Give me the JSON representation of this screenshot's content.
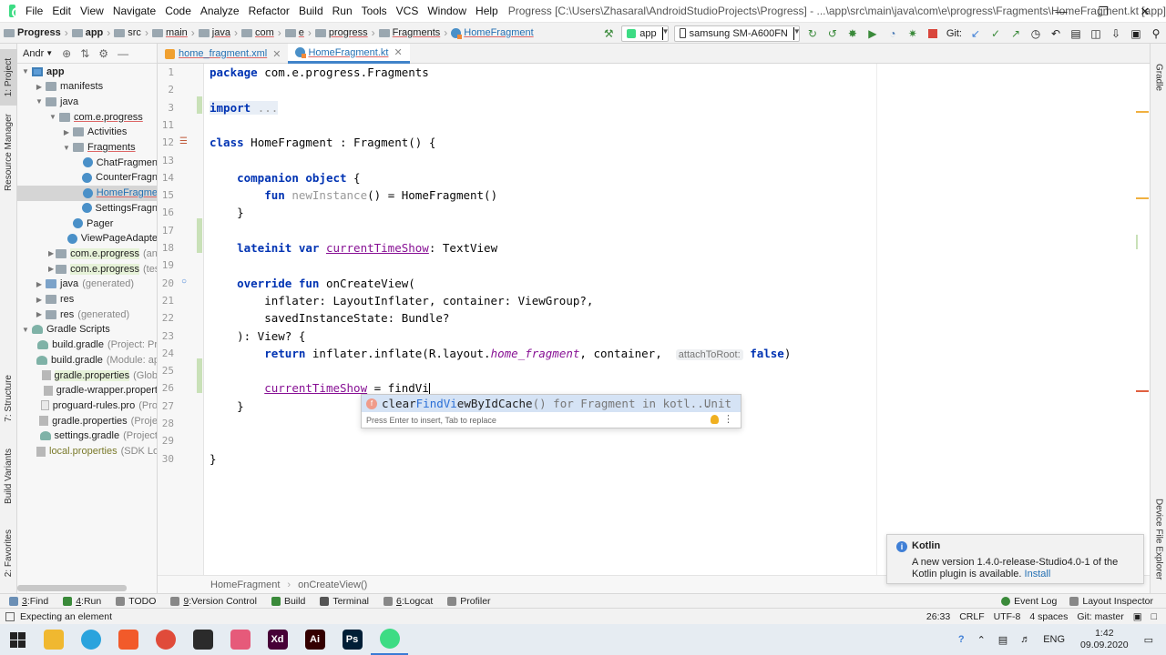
{
  "menu": {
    "items": [
      "File",
      "Edit",
      "View",
      "Navigate",
      "Code",
      "Analyze",
      "Refactor",
      "Build",
      "Run",
      "Tools",
      "VCS",
      "Window",
      "Help"
    ],
    "window_title": "Progress [C:\\Users\\Zhasaral\\AndroidStudioProjects\\Progress] - ...\\app\\src\\main\\java\\com\\e\\progress\\Fragments\\HomeFragment.kt [app]"
  },
  "navbar": {
    "crumbs": [
      "Progress",
      "app",
      "src",
      "main",
      "java",
      "com",
      "e",
      "progress",
      "Fragments",
      "HomeFragment"
    ],
    "run_config": "app",
    "device": "samsung SM-A600FN",
    "git_label": "Git:"
  },
  "left_strip": {
    "tabs": [
      "1: Project",
      "Resource Manager",
      "7: Structure",
      "Build Variants",
      "2: Favorites"
    ]
  },
  "project": {
    "header": "Andr",
    "tree": [
      {
        "label": "app",
        "sub": "",
        "depth": 0,
        "arrow": "open",
        "icon": "module",
        "style": "bold"
      },
      {
        "label": "manifests",
        "sub": "",
        "depth": 1,
        "arrow": "closed",
        "icon": "folder",
        "style": ""
      },
      {
        "label": "java",
        "sub": "",
        "depth": 1,
        "arrow": "open",
        "icon": "folder",
        "style": ""
      },
      {
        "label": "com.e.progress",
        "sub": "",
        "depth": 2,
        "arrow": "open",
        "icon": "folder",
        "style": "red"
      },
      {
        "label": "Activities",
        "sub": "",
        "depth": 3,
        "arrow": "closed",
        "icon": "folder",
        "style": ""
      },
      {
        "label": "Fragments",
        "sub": "",
        "depth": 3,
        "arrow": "open",
        "icon": "folder",
        "style": "red"
      },
      {
        "label": "ChatFragmen",
        "sub": "",
        "depth": 4,
        "arrow": "none",
        "icon": "kt",
        "style": ""
      },
      {
        "label": "CounterFragn",
        "sub": "",
        "depth": 4,
        "arrow": "none",
        "icon": "kt",
        "style": ""
      },
      {
        "label": "HomeFragme",
        "sub": "",
        "depth": 4,
        "arrow": "none",
        "icon": "kt",
        "style": "blue",
        "selected": true
      },
      {
        "label": "SettingsFragn",
        "sub": "",
        "depth": 4,
        "arrow": "none",
        "icon": "kt",
        "style": ""
      },
      {
        "label": "Pager",
        "sub": "",
        "depth": 3,
        "arrow": "none",
        "icon": "kt",
        "style": ""
      },
      {
        "label": "ViewPageAdapte",
        "sub": "",
        "depth": 3,
        "arrow": "none",
        "icon": "kt",
        "style": ""
      },
      {
        "label": "com.e.progress",
        "sub": "(and",
        "depth": 2,
        "arrow": "closed",
        "icon": "folder",
        "style": "green-bg"
      },
      {
        "label": "com.e.progress",
        "sub": "(test",
        "depth": 2,
        "arrow": "closed",
        "icon": "folder",
        "style": "green-bg"
      },
      {
        "label": "java",
        "sub": "(generated)",
        "depth": 1,
        "arrow": "closed",
        "icon": "folder-blue",
        "style": ""
      },
      {
        "label": "res",
        "sub": "",
        "depth": 1,
        "arrow": "closed",
        "icon": "folder",
        "style": ""
      },
      {
        "label": "res",
        "sub": "(generated)",
        "depth": 1,
        "arrow": "closed",
        "icon": "folder",
        "style": ""
      },
      {
        "label": "Gradle Scripts",
        "sub": "",
        "depth": 0,
        "arrow": "open",
        "icon": "gradle",
        "style": ""
      },
      {
        "label": "build.gradle",
        "sub": "(Project: Pr",
        "depth": 1,
        "arrow": "none",
        "icon": "gradle",
        "style": ""
      },
      {
        "label": "build.gradle",
        "sub": "(Module: ap",
        "depth": 1,
        "arrow": "none",
        "icon": "gradle",
        "style": ""
      },
      {
        "label": "gradle.properties",
        "sub": "(Glob",
        "depth": 1,
        "arrow": "none",
        "icon": "props",
        "style": "green-bg"
      },
      {
        "label": "gradle-wrapper.propert",
        "sub": "",
        "depth": 1,
        "arrow": "none",
        "icon": "props",
        "style": ""
      },
      {
        "label": "proguard-rules.pro",
        "sub": "(Pro",
        "depth": 1,
        "arrow": "none",
        "icon": "file",
        "style": ""
      },
      {
        "label": "gradle.properties",
        "sub": "(Proje",
        "depth": 1,
        "arrow": "none",
        "icon": "props",
        "style": ""
      },
      {
        "label": "settings.gradle",
        "sub": "(Project",
        "depth": 1,
        "arrow": "none",
        "icon": "gradle",
        "style": ""
      },
      {
        "label": "local.properties",
        "sub": "(SDK Lo",
        "depth": 1,
        "arrow": "none",
        "icon": "props",
        "style": "olive"
      }
    ]
  },
  "editor": {
    "tabs": [
      {
        "label": "home_fragment.xml",
        "icon": "xml",
        "active": false
      },
      {
        "label": "HomeFragment.kt",
        "icon": "kt",
        "active": true
      }
    ],
    "lines": [
      {
        "n": "1",
        "html": "<span class='kw'>package</span> com.e.progress.Fragments"
      },
      {
        "n": "2",
        "html": ""
      },
      {
        "n": "3",
        "html": "<span class='fold-bg'><span class='kw'>import</span> <span class='muted'>...</span></span>"
      },
      {
        "n": "11",
        "html": ""
      },
      {
        "n": "12",
        "html": "<span class='kw'>class</span> HomeFragment : Fragment() {"
      },
      {
        "n": "13",
        "html": ""
      },
      {
        "n": "14",
        "html": "    <span class='kw'>companion object</span> {"
      },
      {
        "n": "15",
        "html": "        <span class='kw'>fun</span> <span class='muted'>newInstance</span>() = HomeFragment()"
      },
      {
        "n": "16",
        "html": "    }"
      },
      {
        "n": "17",
        "html": ""
      },
      {
        "n": "18",
        "html": "    <span class='kw'>lateinit var</span> <span class='prop'>currentTimeShow</span>: TextView"
      },
      {
        "n": "19",
        "html": ""
      },
      {
        "n": "20",
        "html": "    <span class='kw'>override fun</span> onCreateView("
      },
      {
        "n": "21",
        "html": "        inflater: LayoutInflater, container: ViewGroup?,"
      },
      {
        "n": "22",
        "html": "        savedInstanceState: Bundle?"
      },
      {
        "n": "23",
        "html": "    ): View? {"
      },
      {
        "n": "24",
        "html": "        <span class='kw'>return</span> inflater.inflate(R.layout.<span class='ital'>home_fragment</span>, container,  <span class='hint'>attachToRoot:</span> <span class='kw'>false</span>)"
      },
      {
        "n": "25",
        "html": ""
      },
      {
        "n": "26",
        "html": "        <span class='prop'>currentTimeShow</span> = findVi<span class='caret'></span>"
      },
      {
        "n": "27",
        "html": "    }"
      },
      {
        "n": "28",
        "html": ""
      },
      {
        "n": "29",
        "html": ""
      },
      {
        "n": "30",
        "html": "}"
      }
    ],
    "breadcrumb": [
      "HomeFragment",
      "onCreateView()"
    ]
  },
  "completion": {
    "icon_letter": "f",
    "prefix": "clear",
    "match": "FindVi",
    "rest": "ewByIdCache",
    "meta": "() for Fragment in kotl...",
    "type": "Unit",
    "footer": "Press Enter to insert, Tab to replace"
  },
  "right_strip": {
    "tabs": [
      "Gradle",
      "Device File Explorer"
    ]
  },
  "notification": {
    "title": "Kotlin",
    "body": "A new version 1.4.0-release-Studio4.0-1 of the Kotlin plugin is available.",
    "link": "Install"
  },
  "bottom_tools": {
    "left": [
      {
        "num": "3",
        "label": "Find",
        "color": "#6b8fb5"
      },
      {
        "num": "4",
        "label": "Run",
        "color": "#3a8a3a"
      },
      {
        "num": "",
        "label": "TODO",
        "color": "#888888"
      },
      {
        "num": "9",
        "label": "Version Control",
        "color": "#888888"
      },
      {
        "num": "",
        "label": "Build",
        "color": "#3a8a3a"
      },
      {
        "num": "",
        "label": "Terminal",
        "color": "#555555"
      },
      {
        "num": "6",
        "label": "Logcat",
        "color": "#888888"
      },
      {
        "num": "",
        "label": "Profiler",
        "color": "#888888"
      }
    ],
    "right": [
      "Event Log",
      "Layout Inspector"
    ]
  },
  "status": {
    "message": "Expecting an element",
    "position": "26:33",
    "line_sep": "CRLF",
    "encoding": "UTF-8",
    "indent": "4 spaces",
    "git": "Git: master"
  },
  "taskbar": {
    "apps": [
      {
        "name": "file-explorer",
        "color": "#f0b830",
        "text": ""
      },
      {
        "name": "telegram",
        "color": "#2aa3dd",
        "text": ""
      },
      {
        "name": "brave",
        "color": "#f25a2a",
        "text": ""
      },
      {
        "name": "chrome",
        "color": "#e04b3a",
        "text": ""
      },
      {
        "name": "figma",
        "color": "#2b2b2b",
        "text": ""
      },
      {
        "name": "sketchbook",
        "color": "#e65a7a",
        "text": ""
      },
      {
        "name": "adobe-xd",
        "color": "#470137",
        "text": "Xd"
      },
      {
        "name": "illustrator",
        "color": "#330000",
        "text": "Ai"
      },
      {
        "name": "photoshop",
        "color": "#001e36",
        "text": "Ps"
      },
      {
        "name": "android-studio",
        "color": "#3ddc84",
        "text": ""
      }
    ],
    "lang": "ENG",
    "time": "1:42",
    "date": "09.09.2020"
  }
}
